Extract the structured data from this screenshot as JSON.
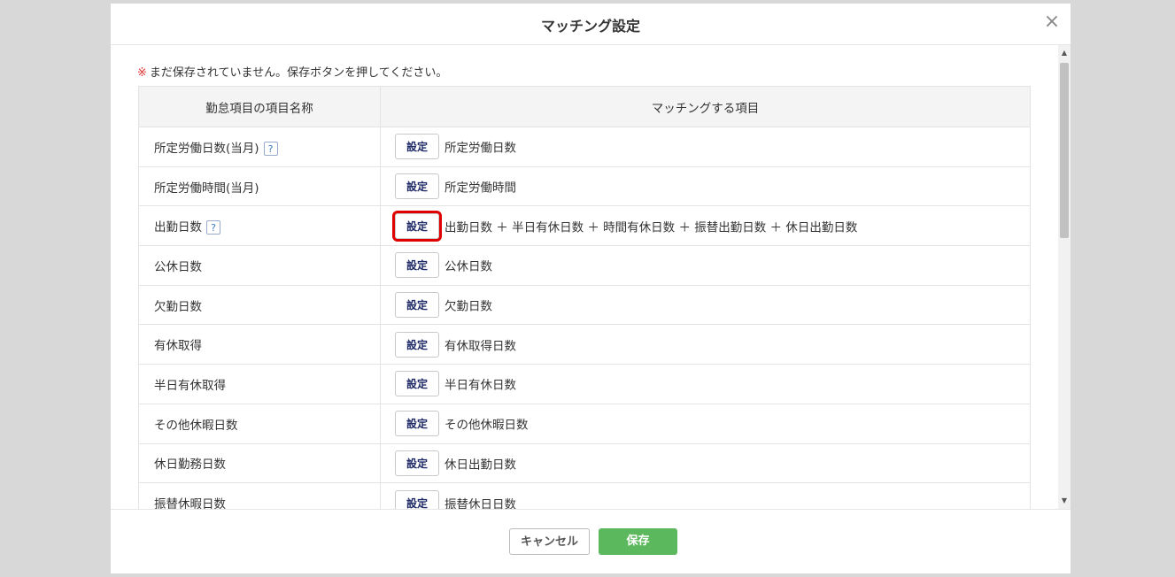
{
  "dialog": {
    "title": "マッチング設定",
    "close_icon": "×"
  },
  "notice": {
    "mark": "※",
    "text": "まだ保存されていません。保存ボタンを押してください。"
  },
  "table": {
    "headers": [
      "勤怠項目の項目名称",
      "マッチングする項目"
    ],
    "button_label": "設定",
    "help_label": "?",
    "rows": [
      {
        "name": "所定労働日数(当月)",
        "help": true,
        "match": "所定労働日数"
      },
      {
        "name": "所定労働時間(当月)",
        "help": false,
        "match": "所定労働時間"
      },
      {
        "name": "出勤日数",
        "help": true,
        "match": "出勤日数 ＋ 半日有休日数 ＋ 時間有休日数 ＋ 振替出勤日数 ＋ 休日出勤日数",
        "highlighted": true
      },
      {
        "name": "公休日数",
        "help": false,
        "match": "公休日数"
      },
      {
        "name": "欠勤日数",
        "help": false,
        "match": "欠勤日数"
      },
      {
        "name": "有休取得",
        "help": false,
        "match": "有休取得日数"
      },
      {
        "name": "半日有休取得",
        "help": false,
        "match": "半日有休日数"
      },
      {
        "name": "その他休暇日数",
        "help": false,
        "match": "その他休暇日数"
      },
      {
        "name": "休日勤務日数",
        "help": false,
        "match": "休日出勤日数"
      },
      {
        "name": "振替休暇日数",
        "help": false,
        "match": "振替休日日数"
      }
    ]
  },
  "footer": {
    "cancel_label": "キャンセル",
    "save_label": "保存"
  },
  "colors": {
    "highlight": "#e00000",
    "save_button": "#5cb85c",
    "notice_mark": "#dd3333"
  }
}
